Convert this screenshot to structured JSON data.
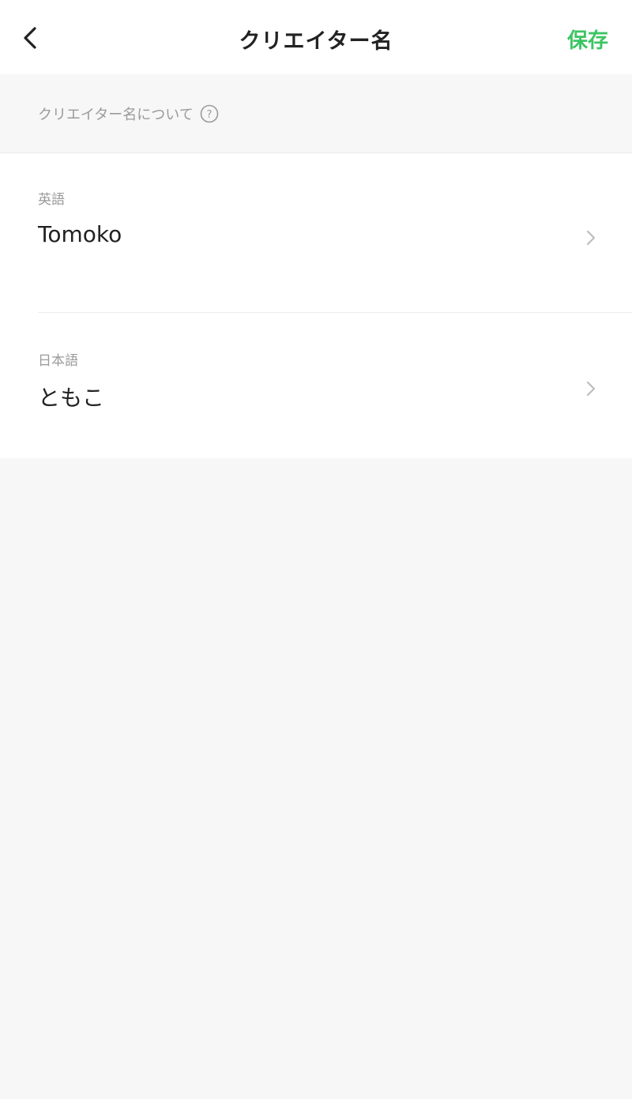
{
  "header": {
    "title": "クリエイター名",
    "save_label": "保存",
    "accent_color": "#3cc463",
    "back_icon": "chevron-left-icon"
  },
  "info": {
    "text": "クリエイター名について",
    "icon": "help-circle-icon"
  },
  "names": [
    {
      "label": "英語",
      "value": "Tomoko"
    },
    {
      "label": "日本語",
      "value": "ともこ"
    }
  ]
}
